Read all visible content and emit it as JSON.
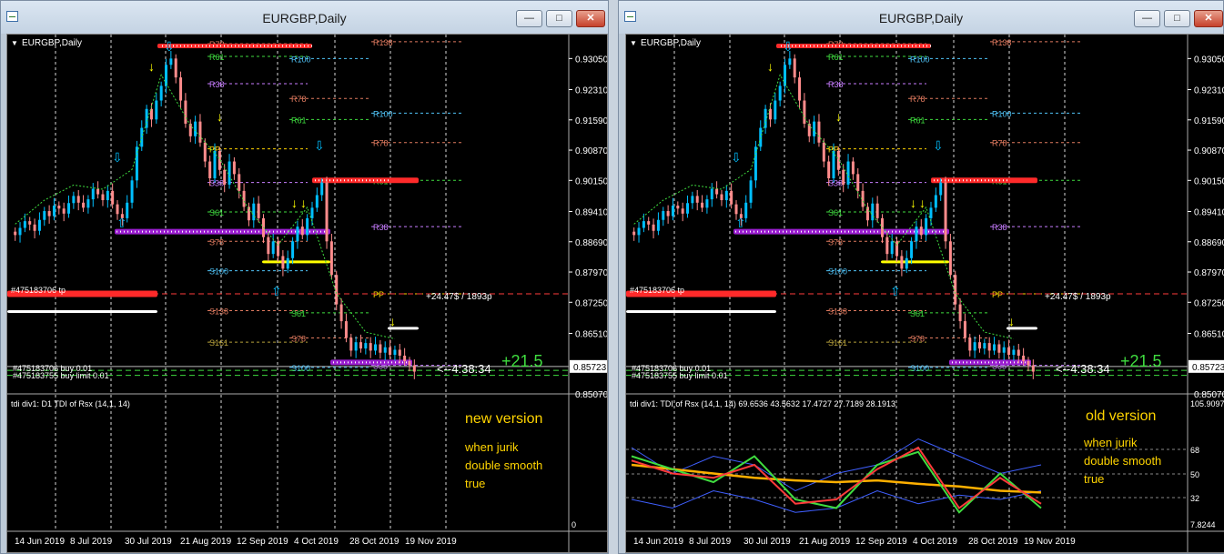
{
  "windows": [
    {
      "title": "EURGBP,Daily",
      "symbol_label": "EURGBP,Daily",
      "indicator_label": "tdi div1: D1 TDI of Rsx  (14,1, 14)",
      "indicator_axis": [
        "0"
      ],
      "note_title": "new version",
      "note_lines": [
        "when jurik",
        "double smooth",
        "true"
      ]
    },
    {
      "title": "EURGBP,Daily",
      "symbol_label": "EURGBP,Daily",
      "indicator_label": "tdi div1: TDI of Rsx  (14,1, 14) 69.6536 43.5632 17.4727 27.7189 28.1913",
      "indicator_axis": [
        "105.9097",
        "68",
        "50",
        "32",
        "7.8244"
      ],
      "note_title": "old version",
      "note_lines": [
        "when jurik",
        "double smooth",
        "true"
      ]
    }
  ],
  "price_axis": [
    "0.93050",
    "0.92310",
    "0.91590",
    "0.90870",
    "0.90150",
    "0.89410",
    "0.88690",
    "0.87970",
    "0.87250",
    "0.86510"
  ],
  "current_price": "0.85723",
  "bottom_price": "0.85070",
  "date_axis": [
    "14 Jun 2019",
    "8 Jul 2019",
    "30 Jul 2019",
    "21 Aug 2019",
    "12 Sep 2019",
    "4 Oct 2019",
    "28 Oct 2019",
    "19 Nov 2019"
  ],
  "order_labels": {
    "tp": "#475183706 tp",
    "buy": "#475183706 buy 0.01",
    "buy_limit": "#475183755 buy limit 0.01",
    "profit": "+24.47$ / 1893p",
    "timer": "<--4:38:34",
    "score": "+21.5"
  },
  "level_labels": {
    "r78": "R78",
    "r61": "R61",
    "r38": "R38",
    "r100": "R100",
    "r138": "R138",
    "r161": "R161",
    "s38": "S38",
    "s61": "S61",
    "s78": "S78",
    "s100": "S100",
    "s138": "S138",
    "s161": "S161",
    "pp": "PP"
  },
  "window_buttons": {
    "minimize": "—",
    "maximize": "□",
    "close": "✕"
  },
  "colors": {
    "bull": "#00bfff",
    "bear": "#ff8c8c",
    "resistance": "#ff2a2a",
    "support": "#ffff00",
    "purple": "#9b1fd1",
    "rsi_green": "#3fdc3f",
    "rsi_orange": "#ffb000",
    "band_blue": "#3f5fff",
    "note_yellow": "#ffd400"
  },
  "chart_data": {
    "type": "candlestick",
    "symbol": "EURGBP",
    "timeframe": "Daily",
    "x_ticks": [
      "14 Jun 2019",
      "8 Jul 2019",
      "30 Jul 2019",
      "21 Aug 2019",
      "12 Sep 2019",
      "4 Oct 2019",
      "28 Oct 2019",
      "19 Nov 2019"
    ],
    "ylim": [
      0.8507,
      0.9362
    ],
    "close": [
      0.8885,
      0.8902,
      0.8918,
      0.891,
      0.8895,
      0.8921,
      0.8942,
      0.893,
      0.8955,
      0.8948,
      0.8936,
      0.8961,
      0.8978,
      0.8962,
      0.895,
      0.897,
      0.8995,
      0.8982,
      0.8968,
      0.899,
      0.8958,
      0.8935,
      0.8925,
      0.8962,
      0.9015,
      0.9095,
      0.914,
      0.9185,
      0.916,
      0.9205,
      0.924,
      0.929,
      0.9305,
      0.926,
      0.9205,
      0.915,
      0.912,
      0.9155,
      0.9105,
      0.906,
      0.902,
      0.9085,
      0.904,
      0.9005,
      0.906,
      0.903,
      0.899,
      0.8952,
      0.892,
      0.896,
      0.8925,
      0.888,
      0.884,
      0.887,
      0.8835,
      0.8805,
      0.883,
      0.887,
      0.8905,
      0.8885,
      0.8925,
      0.895,
      0.898,
      0.901,
      0.887,
      0.879,
      0.872,
      0.868,
      0.864,
      0.861,
      0.863,
      0.8615,
      0.8628,
      0.861,
      0.8625,
      0.8605,
      0.8618,
      0.86,
      0.8612,
      0.8598,
      0.8585,
      0.8575,
      0.856
    ],
    "last_price": 0.85723,
    "indicator": {
      "name": "TDI of Rsx",
      "params": "(14,1, 14)",
      "values_old_version": [
        69.6536,
        43.5632,
        17.4727,
        27.7189,
        28.1913
      ],
      "levels": [
        68,
        50,
        32
      ]
    }
  }
}
